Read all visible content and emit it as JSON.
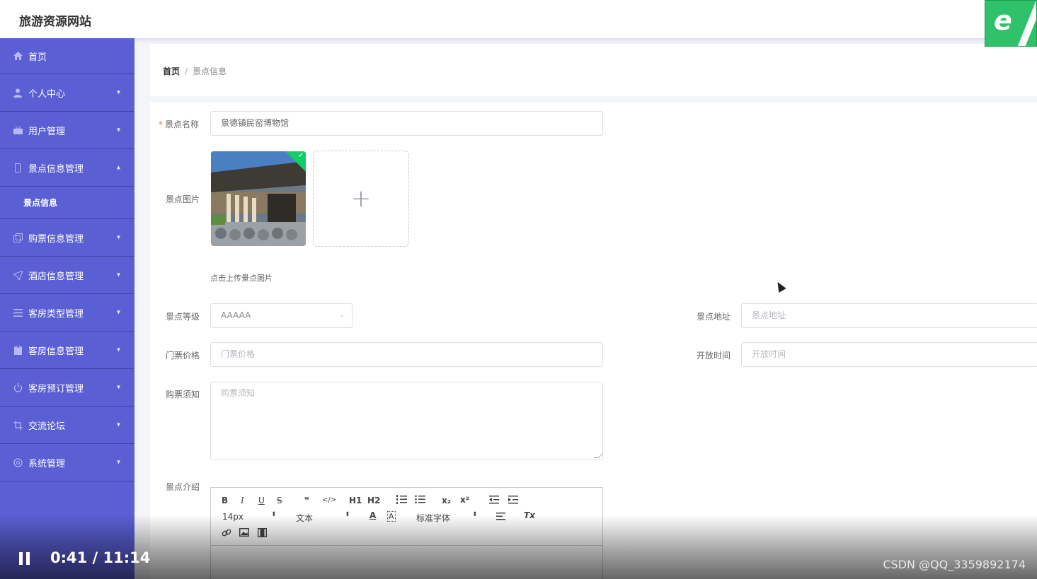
{
  "header": {
    "title": "旅游资源网站",
    "logo_icon": "e-logo-icon"
  },
  "sidebar": {
    "items": [
      {
        "label": "首页",
        "icon": "home-icon"
      },
      {
        "label": "个人中心",
        "icon": "user-icon"
      },
      {
        "label": "用户管理",
        "icon": "briefcase-icon"
      },
      {
        "label": "景点信息管理",
        "icon": "phone-icon",
        "expanded": true
      },
      {
        "label": "购票信息管理",
        "icon": "copy-icon"
      },
      {
        "label": "酒店信息管理",
        "icon": "send-icon"
      },
      {
        "label": "客房类型管理",
        "icon": "list-icon"
      },
      {
        "label": "客房信息管理",
        "icon": "clipboard-icon"
      },
      {
        "label": "客房预订管理",
        "icon": "power-icon"
      },
      {
        "label": "交流论坛",
        "icon": "crop-icon"
      },
      {
        "label": "系统管理",
        "icon": "settings-icon"
      }
    ],
    "sub_item": "景点信息"
  },
  "breadcrumb": {
    "home": "首页",
    "separator": "/",
    "current": "景点信息"
  },
  "form": {
    "name_label": "景点名称",
    "name_value": "景德镇民窑博物馆",
    "image_label": "景点图片",
    "upload_hint": "点击上传景点图片",
    "grade_label": "景点等级",
    "grade_value": "AAAAA",
    "address_label": "景点地址",
    "address_placeholder": "景点地址",
    "price_label": "门票价格",
    "price_placeholder": "门票价格",
    "open_label": "开放时间",
    "open_placeholder": "开放时间",
    "notice_label": "购票须知",
    "notice_placeholder": "购票须知",
    "intro_label": "景点介绍"
  },
  "editor": {
    "font_size": "14px",
    "block_type": "文本",
    "font_family": "标准字体",
    "buttons": [
      "B",
      "I",
      "U",
      "S",
      "❞",
      "</>",
      "H1",
      "H2",
      "x₂",
      "x²",
      "Tx"
    ]
  },
  "video": {
    "time": "0:41 / 11:14",
    "watermark": "CSDN @QQ_3359892174"
  },
  "colors": {
    "sidebar": "#5a5fd4",
    "accent": "#13ce66",
    "required": "#f56c6c"
  }
}
